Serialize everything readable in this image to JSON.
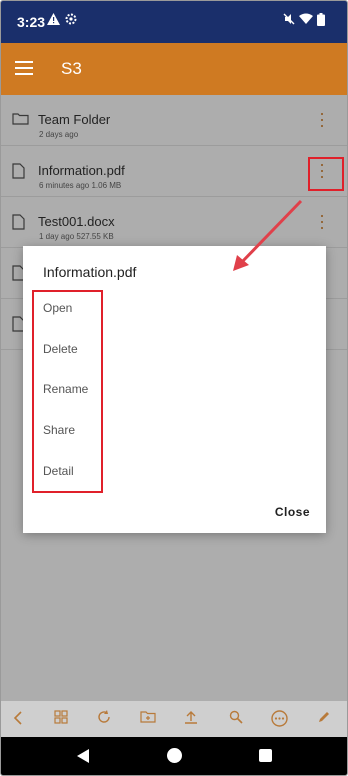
{
  "status_bar": {
    "time": "3:23"
  },
  "app_bar": {
    "title": "S3"
  },
  "files": [
    {
      "name": "Team Folder",
      "meta": "2 days ago",
      "type": "folder"
    },
    {
      "name": "Information.pdf",
      "meta": "6 minutes ago   1.06 MB",
      "type": "file"
    },
    {
      "name": "Test001.docx",
      "meta": "1 day ago   527.55 KB",
      "type": "file"
    },
    {
      "name": "",
      "meta": "",
      "type": "file"
    },
    {
      "name": "",
      "meta": "",
      "type": "file"
    }
  ],
  "dialog": {
    "title": "Information.pdf",
    "options": [
      "Open",
      "Delete",
      "Rename",
      "Share",
      "Detail"
    ],
    "close_label": "Close"
  },
  "colors": {
    "primary": "#cf7a22",
    "status_bar": "#1a2f6b",
    "annotation": "#e0202a"
  },
  "toolbar_icons": [
    "back-icon",
    "grid-icon",
    "refresh-icon",
    "new-folder-icon",
    "upload-icon",
    "search-icon",
    "more-icon",
    "edit-icon"
  ]
}
